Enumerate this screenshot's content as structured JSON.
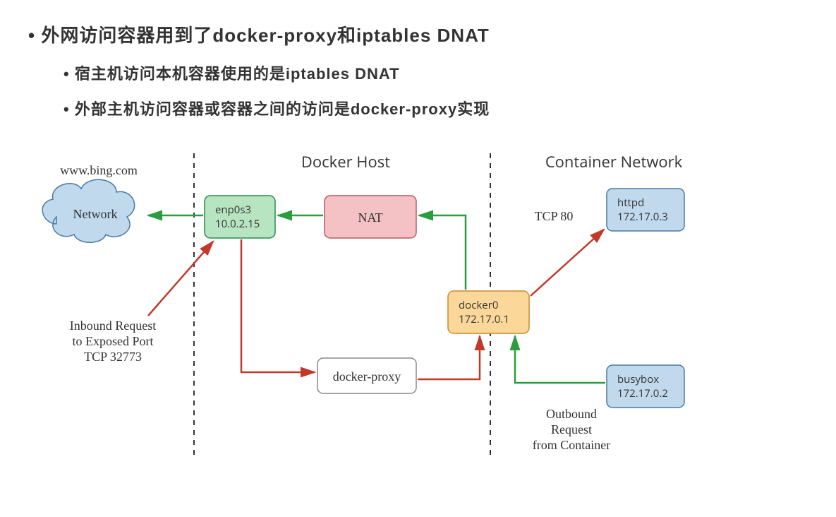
{
  "bullets": {
    "main": "外网访问容器用到了docker-proxy和iptables DNAT",
    "sub1": "宿主机访问本机容器使用的是iptables DNAT",
    "sub2": "外部主机访问容器或容器之间的访问是docker-proxy实现"
  },
  "diagram": {
    "external_url": "www.bing.com",
    "cloud_label": "Network",
    "host_header": "Docker Host",
    "container_header": "Container Network",
    "enp0s3": {
      "name": "enp0s3",
      "ip": "10.0.2.15"
    },
    "nat_label": "NAT",
    "docker_proxy_label": "docker-proxy",
    "docker0": {
      "name": "docker0",
      "ip": "172.17.0.1"
    },
    "httpd": {
      "name": "httpd",
      "ip": "172.17.0.3"
    },
    "busybox": {
      "name": "busybox",
      "ip": "172.17.0.2"
    },
    "tcp80": "TCP 80",
    "inbound": {
      "l1": "Inbound Request",
      "l2": "to Exposed Port",
      "l3": "TCP 32773"
    },
    "outbound": {
      "l1": "Outbound",
      "l2": "Request",
      "l3": "from Container"
    }
  }
}
